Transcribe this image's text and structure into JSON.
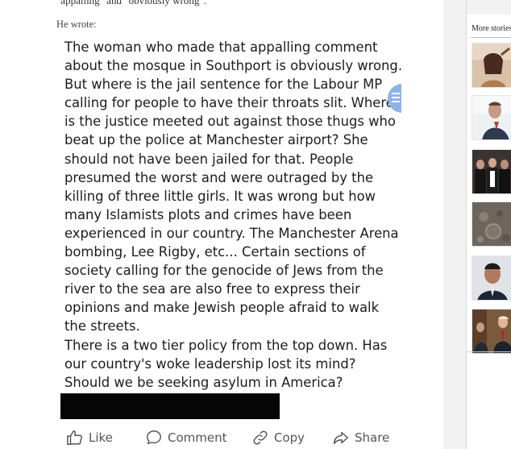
{
  "article": {
    "top_quote": "\"appalling\" and \"obviously wrong\".",
    "lead_in": "He wrote:"
  },
  "post": {
    "paragraphs": [
      "The woman who made that appalling comment about the mosque in Southport is obviously wrong. But where is the jail sentence for the Labour MP calling for people to have their throats slit. Where is the justice meeted out against those thugs who beat up the police at Manchester airport? She should not have been jailed for that. People presumed the worst and were outraged by the killing of three little girls. It was wrong but how many Islamists plots and crimes have been experienced in our country. The Manchester Arena bombing, Lee Rigby, etc... Certain sections of society calling for the genocide of Jews from the river to the sea are also free to express their opinions and make Jewish people afraid to walk the streets.",
      "There is a two tier policy from the top down. Has our country's woke leadership lost its mind? Should we be seeking asylum in America?"
    ],
    "actions": {
      "like": "Like",
      "comment": "Comment",
      "copy": "Copy",
      "share": "Share"
    },
    "icons": [
      "thumbs-up-icon",
      "comment-icon",
      "link-icon",
      "share-icon",
      "chat-bubble-icon"
    ]
  },
  "sidebar": {
    "heading": "More stories"
  }
}
